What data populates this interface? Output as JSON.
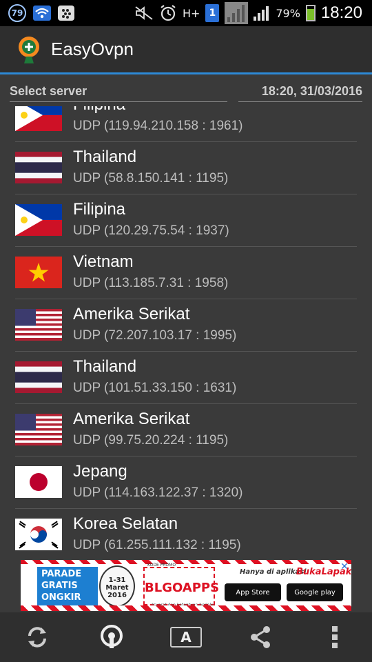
{
  "status_bar": {
    "notification_count": "79",
    "network_type": "H+",
    "sim_slot": "1",
    "battery_percent": "79%",
    "battery_level": 0.79,
    "time": "18:20"
  },
  "app": {
    "title": "EasyOvpn"
  },
  "header": {
    "select_label": "Select server",
    "datetime": "18:20, 31/03/2016"
  },
  "servers": [
    {
      "country": "Filipina",
      "protocol": "UDP (119.94.210.158 : 1961)",
      "flag": "philippines-flag"
    },
    {
      "country": "Thailand",
      "protocol": "UDP (58.8.150.141 : 1195)",
      "flag": "thailand-flag"
    },
    {
      "country": "Filipina",
      "protocol": "UDP (120.29.75.54 : 1937)",
      "flag": "philippines-flag"
    },
    {
      "country": "Vietnam",
      "protocol": "UDP (113.185.7.31 : 1958)",
      "flag": "vietnam-flag"
    },
    {
      "country": "Amerika Serikat",
      "protocol": "UDP (72.207.103.17 : 1995)",
      "flag": "usa-flag"
    },
    {
      "country": "Thailand",
      "protocol": "UDP (101.51.33.150 : 1631)",
      "flag": "thailand-flag"
    },
    {
      "country": "Amerika Serikat",
      "protocol": "UDP (99.75.20.224 : 1195)",
      "flag": "usa-flag"
    },
    {
      "country": "Jepang",
      "protocol": "UDP (114.163.122.37 : 1320)",
      "flag": "japan-flag"
    },
    {
      "country": "Korea Selatan",
      "protocol": "UDP (61.255.111.132 : 1195)",
      "flag": "south-korea-flag"
    }
  ],
  "ad": {
    "parade_text": "PARADE GRATIS ONGKIR",
    "date_text": "1-31 Maret 2016",
    "promo_label": "KODE PROMO",
    "code": "BLGOAPPS",
    "note": "*syarat dan ketentuan berlaku",
    "only_in": "Hanya di aplikasi",
    "brand": "BukaLapak",
    "app_store": "App Store",
    "google_play": "Google play"
  },
  "bottom_bar": {
    "refresh_icon": "refresh-icon",
    "vpn_icon": "vpn-connect-icon",
    "font_label": "A",
    "share_icon": "share-icon",
    "menu_icon": "overflow-menu-icon"
  },
  "colors": {
    "accent": "#2d8ad6",
    "background": "#3a3a3a",
    "actionbar": "#2e2e2e"
  }
}
